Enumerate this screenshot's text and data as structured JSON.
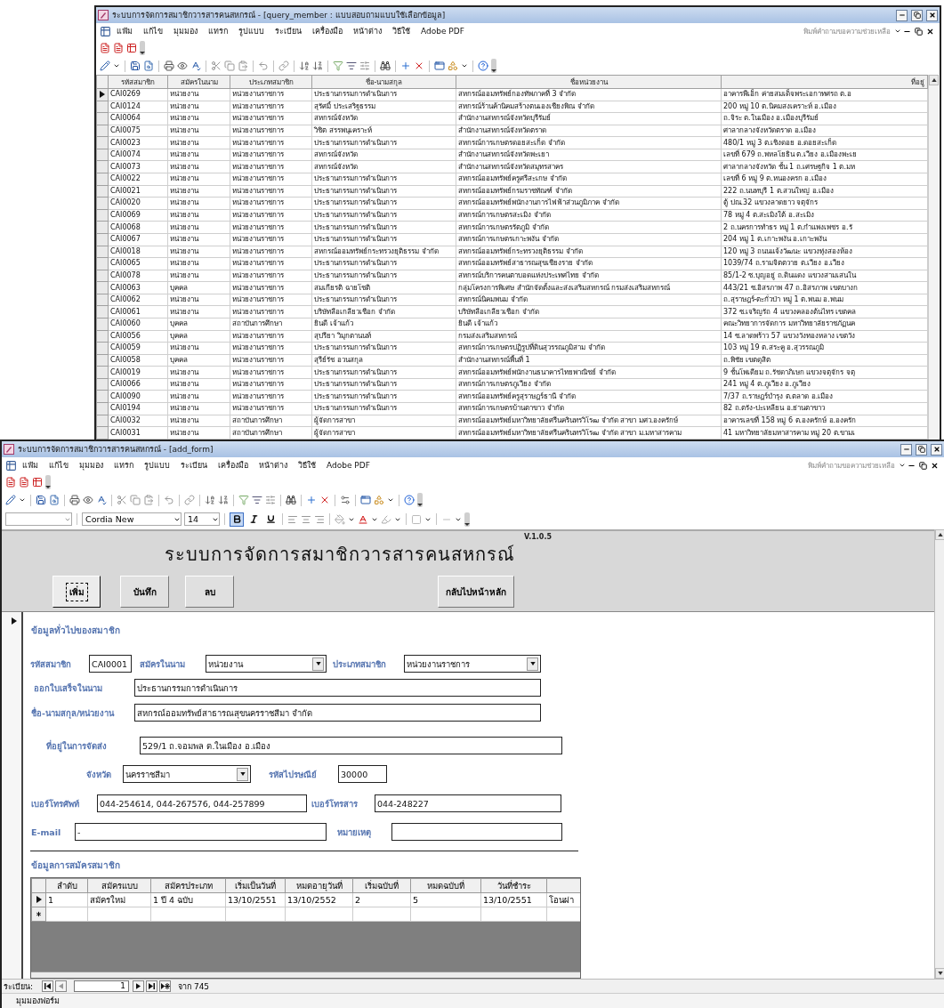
{
  "query_window": {
    "title": "ระบบการจัดการสมาชิกวารสารคนสหกรณ์ - [query_member : แบบสอบถามแบบใช้เลือกข้อมูล]",
    "menu": [
      "แฟ้ม",
      "แก้ไข",
      "มุมมอง",
      "แทรก",
      "รูปแบบ",
      "ระเบียน",
      "เครื่องมือ",
      "หน้าต่าง",
      "วิธีใช้",
      "Adobe PDF"
    ],
    "help_box": "พิมพ์คำถามขอความช่วยเหลือ",
    "table": {
      "columns": [
        "รหัสสมาชิก",
        "สมัครในนาม",
        "ประเภทสมาชิก",
        "ชื่อ-นามสกุล",
        "ชื่อหน่วยงาน",
        "ที่อยู่"
      ],
      "rows": [
        {
          "current": true,
          "cells": [
            "CAI0269",
            "หน่วยงาน",
            "หน่วยงานราชการ",
            "ประธานกรรมการดำเนินการ",
            "สหกรณ์ออมทรัพย์กองทัพภาคที่ 3 จำกัด",
            "อาคารพีเอ็ก ค่ายสมเด็จพระเอกาทศรถ ต.อ"
          ]
        },
        {
          "current": false,
          "cells": [
            "CAI0124",
            "หน่วยงาน",
            "หน่วยงานราชการ",
            "สุรัศมิ์ ประเสริฐธรรม",
            "สหกรณ์ร้านค้านิคมสร้างตนเองเชียงพิณ จำกัด",
            "200 หมู่ 10 ต.นิคมสงเคราะห์ อ.เมือง"
          ]
        },
        {
          "current": false,
          "cells": [
            "CAI0064",
            "หน่วยงาน",
            "หน่วยงานราชการ",
            "สหกรณ์จังหวัด",
            "สำนักงานสหกรณ์จังหวัดบุรีรัมย์",
            "ถ.จิระ ต.ในเมือง อ.เมืองบุรีรัมย์"
          ]
        },
        {
          "current": false,
          "cells": [
            "CAI0075",
            "หน่วยงาน",
            "หน่วยงานราชการ",
            "วิชิต สรรพนุเคราะห์",
            "สำนักงานสหกรณ์จังหวัดตราด",
            "ศาลากลางจังหวัดตราด อ.เมือง"
          ]
        },
        {
          "current": false,
          "cells": [
            "CAI0023",
            "หน่วยงาน",
            "หน่วยงานราชการ",
            "ประธานกรรมการดำเนินการ",
            "สหกรณ์การเกษตรดอยสะเก็ด จำกัด",
            "480/1 หมู่ 3 ต.เชิงดอย อ.ดอยสะเก็ด"
          ]
        },
        {
          "current": false,
          "cells": [
            "CAI0074",
            "หน่วยงาน",
            "หน่วยงานราชการ",
            "สหกรณ์จังหวัด",
            "สำนักงานสหกรณ์จังหวัดพะเยา",
            "เลขที่ 679 ถ.พหลโยธิน ต.เวียง อ.เมืองพะเย"
          ]
        },
        {
          "current": false,
          "cells": [
            "CAI0073",
            "หน่วยงาน",
            "หน่วยงานราชการ",
            "สหกรณ์จังหวัด",
            "สำนักงานสหกรณ์จังหวัดสมุทรสาคร",
            "ศาลากลางจังหวัด ชั้น 1 ถ.เศรษฐกิจ 1 ต.มห"
          ]
        },
        {
          "current": false,
          "cells": [
            "CAI0022",
            "หน่วยงาน",
            "หน่วยงานราชการ",
            "ประธานกรรมการดำเนินการ",
            "สหกรณ์ออมทรัพย์ครูศรีสะเกษ จำกัด",
            "เลขที่ 6 หมู่ 9 ต.หนองครก อ.เมือง"
          ]
        },
        {
          "current": false,
          "cells": [
            "CAI0021",
            "หน่วยงาน",
            "หน่วยงานราชการ",
            "ประธานกรรมการดำเนินการ",
            "สหกรณ์ออมทรัพย์กรมราชทัณฑ์ จำกัด",
            "222 ถ.นนทบุรี 1 ต.สวนใหญ่ อ.เมือง"
          ]
        },
        {
          "current": false,
          "cells": [
            "CAI0020",
            "หน่วยงาน",
            "หน่วยงานราชการ",
            "ประธานกรรมการดำเนินการ",
            "สหกรณ์ออมทรัพย์พนักงานการไฟฟ้าส่วนภูมิภาค จำกัด",
            "ตู้ ปณ.32 แขวงลาดยาว จตุจักร"
          ]
        },
        {
          "current": false,
          "cells": [
            "CAI0069",
            "หน่วยงาน",
            "หน่วยงานราชการ",
            "ประธานกรรมการดำเนินการ",
            "สหกรณ์การเกษตรสะเมิง จำกัด",
            "78 หมู่ 4 ต.สะเมิงใต้ อ.สะเมิง"
          ]
        },
        {
          "current": false,
          "cells": [
            "CAI0068",
            "หน่วยงาน",
            "หน่วยงานราชการ",
            "ประธานกรรมการดำเนินการ",
            "สหกรณ์การเกษตรรัตภูมิ จำกัด",
            "2 ถ.นครการทำธร หมู่ 1 ต.กำแพงเพชร อ.รั"
          ]
        },
        {
          "current": false,
          "cells": [
            "CAI0067",
            "หน่วยงาน",
            "หน่วยงานราชการ",
            "ประธานกรรมการดำเนินการ",
            "สหกรณ์การเกษตรเกาะพงัน จำกัด",
            "204 หมู่ 1 ต.เกาะพงัน อ.เกาะพงัน"
          ]
        },
        {
          "current": false,
          "cells": [
            "CAI0018",
            "หน่วยงาน",
            "หน่วยงานราชการ",
            "สหกรณ์ออมทรัพย์กระทรวงยุติธรรม จำกัด",
            "สหกรณ์ออมทรัพย์กระทรวงยุติธรรม จำกัด",
            "120 หมู่ 3 ถนนแจ้งวัฒนะ แขวงทุ่งสองห้อง"
          ]
        },
        {
          "current": false,
          "cells": [
            "CAI0065",
            "หน่วยงาน",
            "หน่วยงานราชการ",
            "ประธานกรรมการดำเนินการ",
            "สหกรณ์ออมทรัพย์สาธารณสุขเชียงราย จำกัด",
            "1039/74 ถ.รามจิตตวาย ต.เวียง อ.เวียง"
          ]
        },
        {
          "current": false,
          "cells": [
            "CAI0078",
            "หน่วยงาน",
            "หน่วยงานราชการ",
            "ประธานกรรมการดำเนินการ",
            "สหกรณ์บริการคนตาบอดแห่งประเทศไทย จำกัด",
            "85/1-2 ซ.บุญอยู่ ถ.ดินแดง แขวงสามเสนใน"
          ]
        },
        {
          "current": false,
          "cells": [
            "CAI0063",
            "บุคคล",
            "หน่วยงานราชการ",
            "สมเกียรติ ฉายโชติ",
            "กลุ่มโครงการพิเศษ สำนักจัดตั้งและส่งเสริมสหกรณ์ กรมส่งเสริมสหกรณ์",
            "443/21 ซ.อิสรภาพ 47 ถ.อิสรภาพ เขตบางก"
          ]
        },
        {
          "current": false,
          "cells": [
            "CAI0062",
            "หน่วยงาน",
            "หน่วยงานราชการ",
            "ประธานกรรมการดำเนินการ",
            "สหกรณ์นิคมพนม จำกัด",
            "ถ.สุราษฎร์-ตะกั่วป่า หมู่ 1 ต.พนม อ.พนม"
          ]
        },
        {
          "current": false,
          "cells": [
            "CAI0061",
            "หน่วยงาน",
            "หน่วยงานราชการ",
            "บริษัทลือเกลียวเชือก จำกัด",
            "บริษัทลือเกลียวเชือก จำกัด",
            "372 ซ.เจริญรัถ 4 แขวงคลองต้นไทร เขตคล"
          ]
        },
        {
          "current": false,
          "cells": [
            "CAI0060",
            "บุคคล",
            "สถาบันการศึกษา",
            "ยินดี เจ้าแก้ว",
            "ยินดี เจ้าแก้ว",
            "คณะวิทยาการจัดการ มหาวิทยาลัยราชภัฏนค"
          ]
        },
        {
          "current": false,
          "cells": [
            "CAI0056",
            "บุคคล",
            "หน่วยงานราชการ",
            "สุปรียา วิมุกตานนท์",
            "กรมส่งเสริมสหกรณ์",
            "14 ซ.ลาดพร้าว 57 แขวงวังทองหลาง เขตวัง"
          ]
        },
        {
          "current": false,
          "cells": [
            "CAI0059",
            "หน่วยงาน",
            "หน่วยงานราชการ",
            "ประธานกรรมการดำเนินการ",
            "สหกรณ์การเกษตรปฏิรูปที่ดินสุวรรณภูมิสาม จำกัด",
            "103 หมู่ 19 ต.สระคู อ.สุวรรณภูมิ"
          ]
        },
        {
          "current": false,
          "cells": [
            "CAI0058",
            "บุคคล",
            "หน่วยงานราชการ",
            "สุรีย์รัช อวนสกุล",
            "สำนักงานสหกรณ์พื้นที่ 1",
            "ถ.พิชัย เขตดุสิต"
          ]
        },
        {
          "current": false,
          "cells": [
            "CAI0019",
            "หน่วยงาน",
            "หน่วยงานราชการ",
            "ประธานกรรมการดำเนินการ",
            "สหกรณ์ออมทรัพย์พนักงานธนาคารไทยพาณิชย์ จำกัด",
            "9 ชั้นโพเดียม ถ.รัชดาภิเษก แขวงจตุจักร จตุ"
          ]
        },
        {
          "current": false,
          "cells": [
            "CAI0066",
            "หน่วยงาน",
            "หน่วยงานราชการ",
            "ประธานกรรมการดำเนินการ",
            "สหกรณ์การเกษตรภูเวียง จำกัด",
            "241 หมู่ 4 ต.ภูเวียง อ.ภูเวียง"
          ]
        },
        {
          "current": false,
          "cells": [
            "CAI0090",
            "หน่วยงาน",
            "หน่วยงานราชการ",
            "ประธานกรรมการดำเนินการ",
            "สหกรณ์ออมทรัพย์ครูสุราษฎร์ธานี จำกัด",
            "7/37 ถ.ราษฎร์บำรุง ต.ตลาด อ.เมือง"
          ]
        },
        {
          "current": false,
          "cells": [
            "CAI0194",
            "หน่วยงาน",
            "หน่วยงานราชการ",
            "ประธานกรรมการดำเนินการ",
            "สหกรณ์การเกษตรบ้านตาขาว จำกัด",
            "82 ถ.ตรัง-ปะเหลียน อ.ย่านตาขาว"
          ]
        },
        {
          "current": false,
          "cells": [
            "CAI0032",
            "หน่วยงาน",
            "สถาบันการศึกษา",
            "ผู้จัดการสาขา",
            "สหกรณ์ออมทรัพย์มหาวิทยาลัยศรีนครินทรวิโรฒ จำกัด สาขา มศว.องครักษ์",
            "อาคารเลขที่ 158 หมู่ 6 ต.องครักษ์ อ.องครัก"
          ]
        },
        {
          "current": false,
          "cells": [
            "CAI0031",
            "หน่วยงาน",
            "สถาบันการศึกษา",
            "ผู้จัดการสาขา",
            "สหกรณ์ออมทรัพย์มหาวิทยาลัยศรีนครินทรวิโรฒ จำกัด สาขา ม.มหาสารคาม",
            "41 มหาวิทยาลัยมหาสารคาม หมู่ 20 ต.ขามเ"
          ]
        }
      ]
    }
  },
  "form_window": {
    "title": "ระบบการจัดการสมาชิกวารสารคนสหกรณ์ - [add_form]",
    "menu": [
      "แฟ้ม",
      "แก้ไข",
      "มุมมอง",
      "แทรก",
      "รูปแบบ",
      "ระเบียน",
      "เครื่องมือ",
      "หน้าต่าง",
      "วิธีใช้",
      "Adobe PDF"
    ],
    "help_box": "พิมพ์คำถามขอความช่วยเหลือ",
    "format_bar": {
      "font": "Cordia New",
      "size": "14",
      "bold": true,
      "italic": false,
      "underline": false
    },
    "form": {
      "heading": "ระบบการจัดการสมาชิกวารสารคนสหกรณ์",
      "version": "V.1.0.5",
      "buttons": [
        {
          "label": "เพิ่ม",
          "focused": true
        },
        {
          "label": "บันทึก",
          "focused": false
        },
        {
          "label": "ลบ",
          "focused": false
        },
        {
          "label": "กลับไปหน้าหลัก",
          "focused": false
        }
      ],
      "general_heading": "ข้อมูลทั่วไปของสมาชิก",
      "field_rows": [
        {
          "fields": [
            {
              "label": "รหัสสมาชิก",
              "value": "CAI0001",
              "kind": "text"
            },
            {
              "label": "สมัครในนาม",
              "value": "หน่วยงาน",
              "kind": "select"
            },
            {
              "label": "ประเภทสมาชิก",
              "value": "หน่วยงานราชการ",
              "kind": "select"
            }
          ]
        },
        {
          "fields": [
            {
              "label": "ออกใบเสร็จในนาม",
              "value": "ประธานกรรมการดำเนินการ",
              "kind": "text"
            }
          ]
        },
        {
          "fields": [
            {
              "label": "ชื่อ-นามสกุล/หน่วยงาน",
              "value": "สหกรณ์ออมทรัพย์สาธารณสุขนครราชสีมา จำกัด",
              "kind": "text"
            }
          ]
        },
        {
          "fields": [
            {
              "label": "ที่อยู่ในการจัดส่ง",
              "value": "529/1 ถ.จอมพล ต.ในเมือง อ.เมือง",
              "kind": "text"
            }
          ]
        },
        {
          "fields": [
            {
              "label": "จังหวัด",
              "value": "นครราชสีมา",
              "kind": "select"
            },
            {
              "label": "รหัสไปรษณีย์",
              "value": "30000",
              "kind": "text"
            }
          ]
        },
        {
          "fields": [
            {
              "label": "เบอร์โทรศัพท์",
              "value": "044-254614, 044-267576, 044-257899",
              "kind": "text"
            },
            {
              "label": "เบอร์โทรสาร",
              "value": "044-248227",
              "kind": "text"
            }
          ]
        },
        {
          "fields": [
            {
              "label": "E-mail",
              "value": "-",
              "kind": "text"
            },
            {
              "label": "หมายเหตุ",
              "kind": "text"
            }
          ]
        }
      ],
      "subscription_heading": "ข้อมูลการสมัครสมาชิก",
      "subform": {
        "columns": [
          "ลำดับ",
          "สมัครแบบ",
          "สมัครประเภท",
          "เริ่มเป็นวันที่",
          "หมดอายุวันที่",
          "เริ่มฉบับที่",
          "หมดฉบับที่",
          "วันที่ชำระ"
        ],
        "rows": [
          {
            "current": true,
            "cells": [
              "1",
              "สมัครใหม่",
              "1 ปี 4 ฉบับ",
              "13/10/2551",
              "13/10/2552",
              "2",
              "5",
              "13/10/2551",
              "โอนผ่า"
            ]
          }
        ]
      }
    },
    "record_nav": {
      "label": "ระเบียน:",
      "current": "1",
      "total": "จาก 745"
    },
    "status_bar": "มุมมองฟอร์ม"
  }
}
